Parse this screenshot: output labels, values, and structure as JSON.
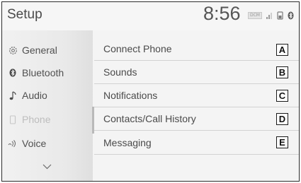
{
  "header": {
    "title": "Setup",
    "time": "8:56",
    "status_badge": "DCM"
  },
  "sidebar": {
    "items": [
      {
        "label": "General",
        "icon": "gear-icon"
      },
      {
        "label": "Bluetooth",
        "icon": "bluetooth-icon"
      },
      {
        "label": "Audio",
        "icon": "music-note-icon"
      },
      {
        "label": "Phone",
        "icon": "phone-icon",
        "selected": true
      },
      {
        "label": "Voice",
        "icon": "voice-icon"
      }
    ],
    "more_icon": "chevron-down-icon"
  },
  "menu": {
    "rows": [
      {
        "label": "Connect Phone",
        "callout": "A"
      },
      {
        "label": "Sounds",
        "callout": "B"
      },
      {
        "label": "Notifications",
        "callout": "C"
      },
      {
        "label": "Contacts/Call History",
        "callout": "D"
      },
      {
        "label": "Messaging",
        "callout": "E"
      }
    ]
  },
  "colors": {
    "background": "#f4f4f4",
    "text": "#4a4a4a",
    "selected_text": "#bdbdbd",
    "divider": "#d2d2d2"
  }
}
